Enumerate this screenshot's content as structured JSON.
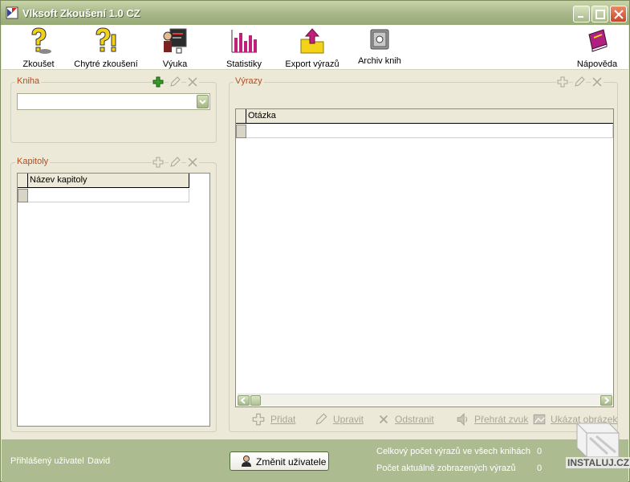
{
  "window": {
    "title": "Vlksoft Zkoušení 1.0 CZ"
  },
  "toolbar": {
    "items": [
      {
        "label": "Zkoušet",
        "icon": "question-person-icon"
      },
      {
        "label": "Chytré zkoušení",
        "icon": "smart-question-icon"
      },
      {
        "label": "Výuka",
        "icon": "teacher-board-icon"
      },
      {
        "label": "Statistiky",
        "icon": "bar-chart-icon"
      },
      {
        "label": "Export výrazů",
        "icon": "export-folder-icon"
      },
      {
        "label": "Archiv knih",
        "icon": "safe-icon"
      },
      {
        "label": "Nápověda",
        "icon": "help-book-icon"
      }
    ]
  },
  "kniha": {
    "title": "Kniha",
    "combo_value": ""
  },
  "kapitoly": {
    "title": "Kapitoly",
    "column": "Název kapitoly"
  },
  "vyrazy": {
    "title": "Výrazy",
    "column": "Otázka",
    "actions": {
      "add": "Přidat",
      "edit": "Upravit",
      "remove": "Odstranit",
      "play": "Přehrát zvuk",
      "show_image": "Ukázat obrázek"
    }
  },
  "status": {
    "logged_label": "Přihlášený uživatel",
    "user": "David",
    "change_user": "Změnit uživatele",
    "total_label": "Celkový počet výrazů ve všech knihách",
    "total_value": "0",
    "shown_label": "Počet aktuálně zobrazených výrazů",
    "shown_value": "0"
  },
  "watermark": "INSTALUJ.CZ",
  "colors": {
    "title_bar": "#A9B98A",
    "group_title": "#B44B1C",
    "status_bar": "#ADBB91"
  }
}
